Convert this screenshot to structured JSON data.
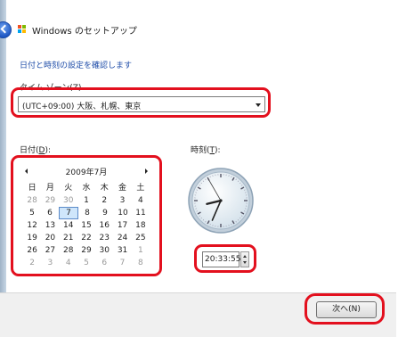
{
  "window": {
    "title": "Windows のセットアップ"
  },
  "heading": "日付と時刻の設定を確認します",
  "timezone": {
    "label_text": "タイム ゾーン(",
    "label_key": "Z",
    "label_end": ")",
    "value": "(UTC+09:00) 大阪、札幌、東京"
  },
  "date": {
    "label_text": "日付(",
    "label_key": "D",
    "label_end": "):"
  },
  "time": {
    "label_text": "時刻(",
    "label_key": "T",
    "label_end": "):",
    "value": "20:33:55",
    "clock": {
      "hour": 20,
      "minute": 33,
      "second": 55
    }
  },
  "calendar": {
    "title": "2009年7月",
    "weekdays": [
      "日",
      "月",
      "火",
      "水",
      "木",
      "金",
      "土"
    ],
    "weeks": [
      [
        "28",
        "29",
        "30",
        "1",
        "2",
        "3",
        "4"
      ],
      [
        "5",
        "6",
        "7",
        "8",
        "9",
        "10",
        "11"
      ],
      [
        "12",
        "13",
        "14",
        "15",
        "16",
        "17",
        "18"
      ],
      [
        "19",
        "20",
        "21",
        "22",
        "23",
        "24",
        "25"
      ],
      [
        "26",
        "27",
        "28",
        "29",
        "30",
        "31",
        "1"
      ],
      [
        "2",
        "3",
        "4",
        "5",
        "6",
        "7",
        "8"
      ]
    ],
    "dimmed": [
      [
        0,
        0
      ],
      [
        0,
        1
      ],
      [
        0,
        2
      ],
      [
        4,
        6
      ],
      [
        5,
        0
      ],
      [
        5,
        1
      ],
      [
        5,
        2
      ],
      [
        5,
        3
      ],
      [
        5,
        4
      ],
      [
        5,
        5
      ],
      [
        5,
        6
      ]
    ],
    "selected": [
      1,
      2
    ]
  },
  "footer": {
    "next_label": "次へ(N)"
  },
  "colors": {
    "highlight": "#e3101e",
    "heading": "#1e4ca8",
    "selected_day": "#cfe6fb"
  }
}
